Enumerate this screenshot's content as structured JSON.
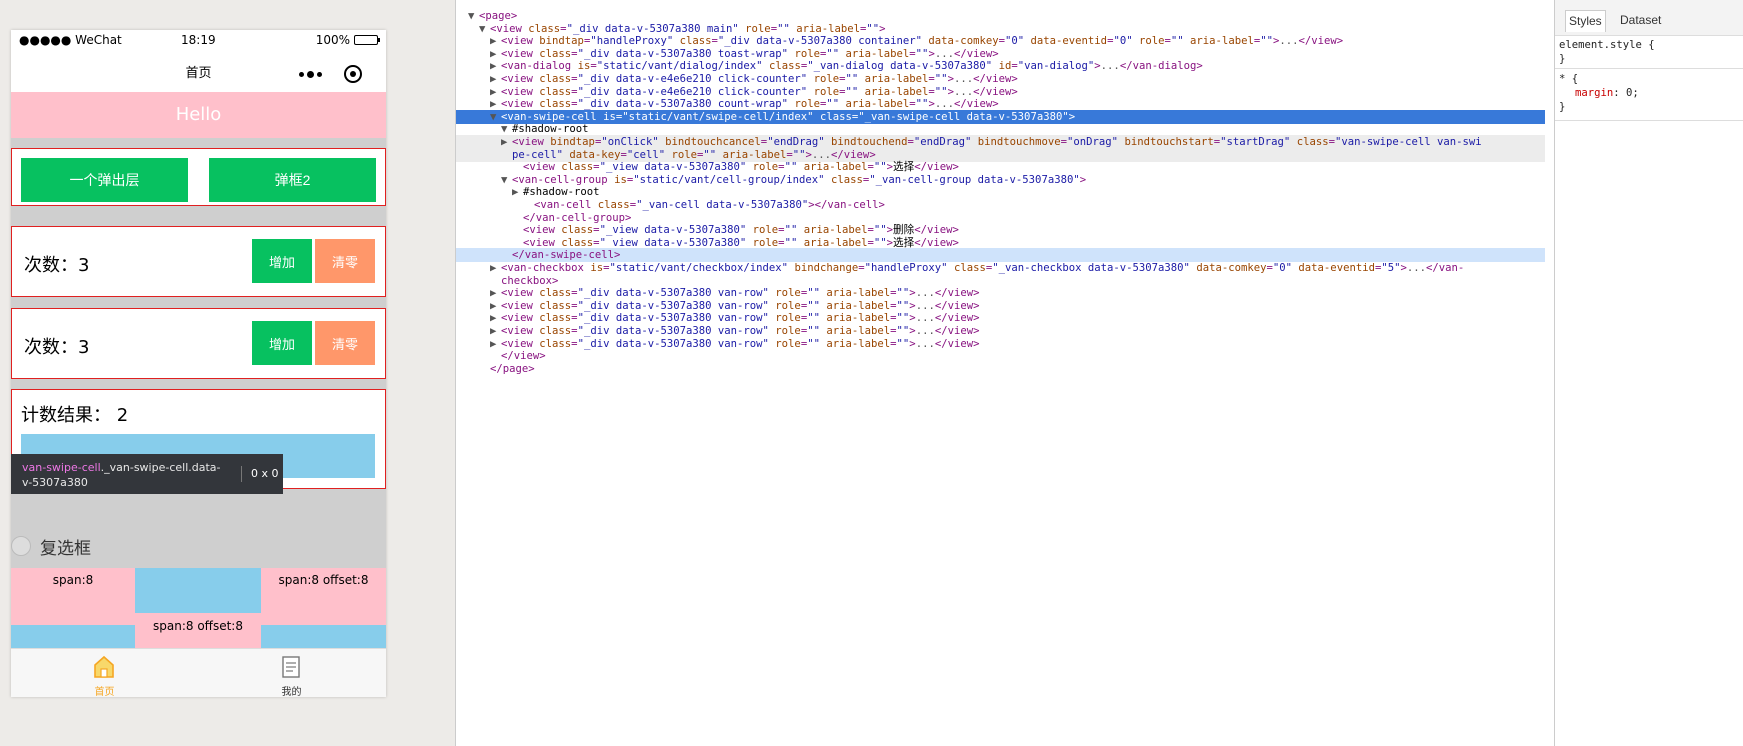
{
  "simulator": {
    "status_bar": {
      "carrier": "●●●●● WeChat",
      "time": "18:19",
      "battery": "100%"
    },
    "nav": {
      "title": "首页"
    },
    "hello": "Hello",
    "popup_buttons": {
      "popup1": "一个弹出层",
      "popup2": "弹框2"
    },
    "counters": [
      {
        "label": "次数：3",
        "add": "增加",
        "clear": "清零"
      },
      {
        "label": "次数：3",
        "add": "增加",
        "clear": "清零"
      }
    ],
    "count_result": "计数结果： 2",
    "tooltip": {
      "selector_tag": "van-swipe-cell",
      "selector_class": "._van-swipe-cell.data-v-5307a380",
      "size": "0 x 0"
    },
    "checkbox_label": "复选框",
    "grid": {
      "span8": "span:8",
      "span8_offset8": "span:8 offset:8",
      "span8_offset8_2": "span:8 offset:8"
    },
    "tabs": [
      {
        "label": "首页",
        "color": "#f5a623"
      },
      {
        "label": "我的",
        "color": "#333333"
      }
    ]
  },
  "elements": {
    "lines": [
      {
        "indent": 0,
        "tri": "▼",
        "html": "<span class=\"tg\">&lt;page&gt;</span>"
      },
      {
        "indent": 1,
        "tri": "▼",
        "html": "<span class=\"tg\">&lt;view</span> <span class=\"an\">class</span>=<span class=\"av\">\"_div data-v-5307a380 main\"</span> <span class=\"an\">role</span>=<span class=\"av\">\"\"</span> <span class=\"an\">aria-label</span>=<span class=\"av\">\"\"</span><span class=\"tg\">&gt;</span>"
      },
      {
        "indent": 2,
        "tri": "▶",
        "html": "<span class=\"tg\">&lt;view</span> <span class=\"an\">bindtap</span>=<span class=\"av\">\"handleProxy\"</span> <span class=\"an\">class</span>=<span class=\"av\">\"_div data-v-5307a380 container\"</span> <span class=\"an\">data-comkey</span>=<span class=\"av\">\"0\"</span> <span class=\"an\">data-eventid</span>=<span class=\"av\">\"0\"</span> <span class=\"an\">role</span>=<span class=\"av\">\"\"</span> <span class=\"an\">aria-label</span>=<span class=\"av\">\"\"</span><span class=\"tg\">&gt;</span><span class=\"ellipsis\">...</span><span class=\"tg\">&lt;/view&gt;</span>"
      },
      {
        "indent": 2,
        "tri": "▶",
        "html": "<span class=\"tg\">&lt;view</span> <span class=\"an\">class</span>=<span class=\"av\">\"_div data-v-5307a380 toast-wrap\"</span> <span class=\"an\">role</span>=<span class=\"av\">\"\"</span> <span class=\"an\">aria-label</span>=<span class=\"av\">\"\"</span><span class=\"tg\">&gt;</span><span class=\"ellipsis\">...</span><span class=\"tg\">&lt;/view&gt;</span>"
      },
      {
        "indent": 2,
        "tri": "▶",
        "html": "<span class=\"tg\">&lt;van-dialog</span> <span class=\"an\">is</span>=<span class=\"av\">\"static/vant/dialog/index\"</span> <span class=\"an\">class</span>=<span class=\"av\">\"_van-dialog data-v-5307a380\"</span> <span class=\"an\">id</span>=<span class=\"av\">\"van-dialog\"</span><span class=\"tg\">&gt;</span><span class=\"ellipsis\">...</span><span class=\"tg\">&lt;/van-dialog&gt;</span>"
      },
      {
        "indent": 2,
        "tri": "▶",
        "html": "<span class=\"tg\">&lt;view</span> <span class=\"an\">class</span>=<span class=\"av\">\"_div data-v-e4e6e210 click-counter\"</span> <span class=\"an\">role</span>=<span class=\"av\">\"\"</span> <span class=\"an\">aria-label</span>=<span class=\"av\">\"\"</span><span class=\"tg\">&gt;</span><span class=\"ellipsis\">...</span><span class=\"tg\">&lt;/view&gt;</span>"
      },
      {
        "indent": 2,
        "tri": "▶",
        "html": "<span class=\"tg\">&lt;view</span> <span class=\"an\">class</span>=<span class=\"av\">\"_div data-v-e4e6e210 click-counter\"</span> <span class=\"an\">role</span>=<span class=\"av\">\"\"</span> <span class=\"an\">aria-label</span>=<span class=\"av\">\"\"</span><span class=\"tg\">&gt;</span><span class=\"ellipsis\">...</span><span class=\"tg\">&lt;/view&gt;</span>"
      },
      {
        "indent": 2,
        "tri": "▶",
        "html": "<span class=\"tg\">&lt;view</span> <span class=\"an\">class</span>=<span class=\"av\">\"_div data-v-5307a380 count-wrap\"</span> <span class=\"an\">role</span>=<span class=\"av\">\"\"</span> <span class=\"an\">aria-label</span>=<span class=\"av\">\"\"</span><span class=\"tg\">&gt;</span><span class=\"ellipsis\">...</span><span class=\"tg\">&lt;/view&gt;</span>"
      },
      {
        "indent": 2,
        "tri": "▼",
        "cls": "selected",
        "html": "<span class=\"tg\">&lt;van-swipe-cell</span> <span class=\"an\">is</span>=<span class=\"av\">\"static/vant/swipe-cell/index\"</span> <span class=\"an\">class</span>=<span class=\"av\">\"_van-swipe-cell data-v-5307a380\"</span><span class=\"tg\">&gt;</span>"
      },
      {
        "indent": 3,
        "tri": "▼",
        "html": "<span class=\"tx\">#shadow-root</span>"
      },
      {
        "indent": 3,
        "tri": "▶",
        "cls": "graybg",
        "html": "<span class=\"tg\">&lt;view</span> <span class=\"an\">bindtap</span>=<span class=\"av\">\"onClick\"</span> <span class=\"an\">bindtouchcancel</span>=<span class=\"av\">\"endDrag\"</span> <span class=\"an\">bindtouchend</span>=<span class=\"av\">\"endDrag\"</span> <span class=\"an\">bindtouchmove</span>=<span class=\"av\">\"onDrag\"</span> <span class=\"an\">bindtouchstart</span>=<span class=\"av\">\"startDrag\"</span> <span class=\"an\">class</span>=<span class=\"av\">\"van-swipe-cell van-swi</span>"
      },
      {
        "indent": 3,
        "tri": "",
        "cls": "graybg",
        "html": "<span class=\"av\">pe-cell\"</span> <span class=\"an\">data-key</span>=<span class=\"av\">\"cell\"</span> <span class=\"an\">role</span>=<span class=\"av\">\"\"</span> <span class=\"an\">aria-label</span>=<span class=\"av\">\"\"</span><span class=\"tg\">&gt;</span><span class=\"ellipsis\">...</span><span class=\"tg\">&lt;/view&gt;</span>"
      },
      {
        "indent": 4,
        "tri": "",
        "html": "<span class=\"tg\">&lt;view</span> <span class=\"an\">class</span>=<span class=\"av\">\"_view data-v-5307a380\"</span> <span class=\"an\">role</span>=<span class=\"av\">\"\"</span> <span class=\"an\">aria-label</span>=<span class=\"av\">\"\"</span><span class=\"tg\">&gt;</span><span class=\"tx\">选择</span><span class=\"tg\">&lt;/view&gt;</span>"
      },
      {
        "indent": 3,
        "tri": "▼",
        "html": "<span class=\"tg\">&lt;van-cell-group</span> <span class=\"an\">is</span>=<span class=\"av\">\"static/vant/cell-group/index\"</span> <span class=\"an\">class</span>=<span class=\"av\">\"_van-cell-group data-v-5307a380\"</span><span class=\"tg\">&gt;</span>"
      },
      {
        "indent": 4,
        "tri": "▶",
        "html": "<span class=\"tx\">#shadow-root</span>"
      },
      {
        "indent": 5,
        "tri": "",
        "html": "<span class=\"tg\">&lt;van-cell</span> <span class=\"an\">class</span>=<span class=\"av\">\"_van-cell data-v-5307a380\"</span><span class=\"tg\">&gt;&lt;/van-cell&gt;</span>"
      },
      {
        "indent": 4,
        "tri": "",
        "html": "<span class=\"tg\">&lt;/van-cell-group&gt;</span>"
      },
      {
        "indent": 4,
        "tri": "",
        "html": "<span class=\"tg\">&lt;view</span> <span class=\"an\">class</span>=<span class=\"av\">\"_view data-v-5307a380\"</span> <span class=\"an\">role</span>=<span class=\"av\">\"\"</span> <span class=\"an\">aria-label</span>=<span class=\"av\">\"\"</span><span class=\"tg\">&gt;</span><span class=\"tx\">删除</span><span class=\"tg\">&lt;/view&gt;</span>"
      },
      {
        "indent": 4,
        "tri": "",
        "html": "<span class=\"tg\">&lt;view</span> <span class=\"an\">class</span>=<span class=\"av\">\"_view data-v-5307a380\"</span> <span class=\"an\">role</span>=<span class=\"av\">\"\"</span> <span class=\"an\">aria-label</span>=<span class=\"av\">\"\"</span><span class=\"tg\">&gt;</span><span class=\"tx\">选择</span><span class=\"tg\">&lt;/view&gt;</span>"
      },
      {
        "indent": 3,
        "tri": "",
        "cls": "hoverbg",
        "html": "<span class=\"tg\">&lt;/van-swipe-cell&gt;</span>"
      },
      {
        "indent": 2,
        "tri": "▶",
        "html": "<span class=\"tg\">&lt;van-checkbox</span> <span class=\"an\">is</span>=<span class=\"av\">\"static/vant/checkbox/index\"</span> <span class=\"an\">bindchange</span>=<span class=\"av\">\"handleProxy\"</span> <span class=\"an\">class</span>=<span class=\"av\">\"_van-checkbox data-v-5307a380\"</span> <span class=\"an\">data-comkey</span>=<span class=\"av\">\"0\"</span> <span class=\"an\">data-eventid</span>=<span class=\"av\">\"5\"</span><span class=\"tg\">&gt;</span><span class=\"ellipsis\">...</span><span class=\"tg\">&lt;/van-</span>"
      },
      {
        "indent": 2,
        "tri": "",
        "html": "<span class=\"tg\">checkbox&gt;</span>"
      },
      {
        "indent": 2,
        "tri": "▶",
        "html": "<span class=\"tg\">&lt;view</span> <span class=\"an\">class</span>=<span class=\"av\">\"_div data-v-5307a380 van-row\"</span> <span class=\"an\">role</span>=<span class=\"av\">\"\"</span> <span class=\"an\">aria-label</span>=<span class=\"av\">\"\"</span><span class=\"tg\">&gt;</span><span class=\"ellipsis\">...</span><span class=\"tg\">&lt;/view&gt;</span>"
      },
      {
        "indent": 2,
        "tri": "▶",
        "html": "<span class=\"tg\">&lt;view</span> <span class=\"an\">class</span>=<span class=\"av\">\"_div data-v-5307a380 van-row\"</span> <span class=\"an\">role</span>=<span class=\"av\">\"\"</span> <span class=\"an\">aria-label</span>=<span class=\"av\">\"\"</span><span class=\"tg\">&gt;</span><span class=\"ellipsis\">...</span><span class=\"tg\">&lt;/view&gt;</span>"
      },
      {
        "indent": 2,
        "tri": "▶",
        "html": "<span class=\"tg\">&lt;view</span> <span class=\"an\">class</span>=<span class=\"av\">\"_div data-v-5307a380 van-row\"</span> <span class=\"an\">role</span>=<span class=\"av\">\"\"</span> <span class=\"an\">aria-label</span>=<span class=\"av\">\"\"</span><span class=\"tg\">&gt;</span><span class=\"ellipsis\">...</span><span class=\"tg\">&lt;/view&gt;</span>"
      },
      {
        "indent": 2,
        "tri": "▶",
        "html": "<span class=\"tg\">&lt;view</span> <span class=\"an\">class</span>=<span class=\"av\">\"_div data-v-5307a380 van-row\"</span> <span class=\"an\">role</span>=<span class=\"av\">\"\"</span> <span class=\"an\">aria-label</span>=<span class=\"av\">\"\"</span><span class=\"tg\">&gt;</span><span class=\"ellipsis\">...</span><span class=\"tg\">&lt;/view&gt;</span>"
      },
      {
        "indent": 2,
        "tri": "▶",
        "html": "<span class=\"tg\">&lt;view</span> <span class=\"an\">class</span>=<span class=\"av\">\"_div data-v-5307a380 van-row\"</span> <span class=\"an\">role</span>=<span class=\"av\">\"\"</span> <span class=\"an\">aria-label</span>=<span class=\"av\">\"\"</span><span class=\"tg\">&gt;</span><span class=\"ellipsis\">...</span><span class=\"tg\">&lt;/view&gt;</span>"
      },
      {
        "indent": 2,
        "tri": "",
        "html": "<span class=\"tg\">&lt;/view&gt;</span>"
      },
      {
        "indent": 1,
        "tri": "",
        "html": "<span class=\"tg\">&lt;/page&gt;</span>"
      }
    ]
  },
  "styles_panel": {
    "tabs": [
      "Styles",
      "Dataset"
    ],
    "element_style": "element.style {",
    "close_brace": "}",
    "universal_selector": "* {",
    "margin_prop": "margin",
    "margin_value": "0;",
    "close_brace2": "}"
  }
}
